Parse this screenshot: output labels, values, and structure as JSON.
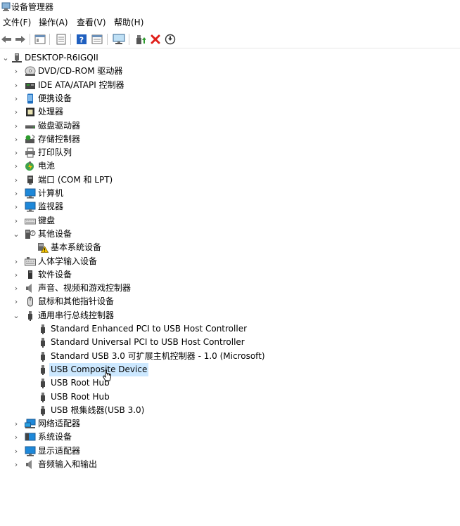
{
  "window": {
    "title": "设备管理器"
  },
  "menu": [
    "文件(F)",
    "操作(A)",
    "查看(V)",
    "帮助(H)"
  ],
  "toolbar": {
    "buttons": [
      "back-icon",
      "forward-icon",
      "properties-view-icon",
      "list-view-icon",
      "help-icon",
      "details-icon",
      "monitor-scan-icon",
      "update-driver-icon",
      "uninstall-icon",
      "download-icon"
    ]
  },
  "tree": {
    "root": "DESKTOP-R6IGQII",
    "categories": [
      {
        "label": "DVD/CD-ROM 驱动器",
        "icon": "dvd-drive-icon",
        "expanded": false
      },
      {
        "label": "IDE ATA/ATAPI 控制器",
        "icon": "ide-controller-icon",
        "expanded": false
      },
      {
        "label": "便携设备",
        "icon": "portable-device-icon",
        "expanded": false
      },
      {
        "label": "处理器",
        "icon": "processor-icon",
        "expanded": false
      },
      {
        "label": "磁盘驱动器",
        "icon": "disk-drive-icon",
        "expanded": false
      },
      {
        "label": "存储控制器",
        "icon": "storage-controller-icon",
        "expanded": false
      },
      {
        "label": "打印队列",
        "icon": "printer-icon",
        "expanded": false
      },
      {
        "label": "电池",
        "icon": "battery-icon",
        "expanded": false
      },
      {
        "label": "端口 (COM 和 LPT)",
        "icon": "port-icon",
        "expanded": false
      },
      {
        "label": "计算机",
        "icon": "computer-icon",
        "expanded": false
      },
      {
        "label": "监视器",
        "icon": "monitor-icon",
        "expanded": false
      },
      {
        "label": "键盘",
        "icon": "keyboard-icon",
        "expanded": false
      },
      {
        "label": "其他设备",
        "icon": "other-devices-icon",
        "expanded": true,
        "children": [
          {
            "label": "基本系统设备",
            "icon": "warning-device-icon"
          }
        ]
      },
      {
        "label": "人体学输入设备",
        "icon": "hid-icon",
        "expanded": false
      },
      {
        "label": "软件设备",
        "icon": "software-device-icon",
        "expanded": false
      },
      {
        "label": "声音、视频和游戏控制器",
        "icon": "sound-icon",
        "expanded": false
      },
      {
        "label": "鼠标和其他指针设备",
        "icon": "mouse-icon",
        "expanded": false
      },
      {
        "label": "通用串行总线控制器",
        "icon": "usb-controller-icon",
        "expanded": true,
        "children": [
          {
            "label": "Standard Enhanced PCI to USB Host Controller",
            "icon": "usb-device-icon"
          },
          {
            "label": "Standard Universal PCI to USB Host Controller",
            "icon": "usb-device-icon"
          },
          {
            "label": "Standard USB 3.0 可扩展主机控制器 - 1.0 (Microsoft)",
            "icon": "usb-device-icon"
          },
          {
            "label": "USB Composite Device",
            "icon": "usb-device-icon",
            "selected": true
          },
          {
            "label": "USB Root Hub",
            "icon": "usb-device-icon"
          },
          {
            "label": "USB Root Hub",
            "icon": "usb-device-icon"
          },
          {
            "label": "USB 根集线器(USB 3.0)",
            "icon": "usb-device-icon"
          }
        ]
      },
      {
        "label": "网络适配器",
        "icon": "network-adapter-icon",
        "expanded": false
      },
      {
        "label": "系统设备",
        "icon": "system-device-icon",
        "expanded": false
      },
      {
        "label": "显示适配器",
        "icon": "display-adapter-icon",
        "expanded": false
      },
      {
        "label": "音频输入和输出",
        "icon": "audio-io-icon",
        "expanded": false
      }
    ]
  },
  "colors": {
    "selection": "#cce8ff",
    "accent": "#0078d7",
    "warning": "#f5c400",
    "uninstall": "#e0201b"
  }
}
